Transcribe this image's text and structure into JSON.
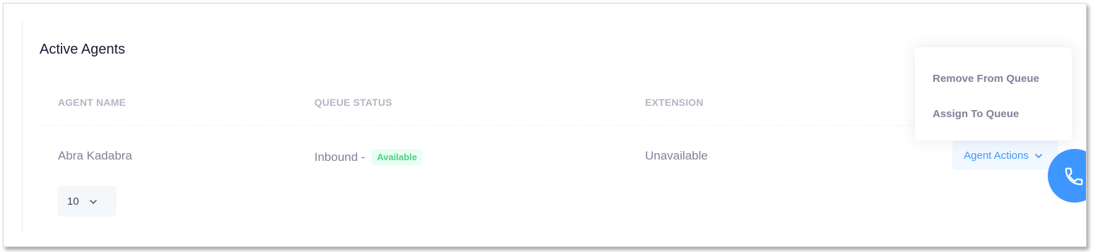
{
  "card": {
    "title": "Active Agents"
  },
  "table": {
    "columns": [
      "AGENT NAME",
      "QUEUE STATUS",
      "EXTENSION"
    ],
    "rows": [
      {
        "agent_name": "Abra Kadabra",
        "queue_status_prefix": "Inbound -",
        "queue_status_badge": "Available",
        "extension": "Unavailable",
        "actions_label": "Agent Actions"
      }
    ]
  },
  "dropdown": {
    "items": [
      "Remove From Queue",
      "Assign To Queue"
    ]
  },
  "pagination": {
    "page_size": "10"
  },
  "icons": {
    "actions_toggle": "chevron-down-icon",
    "page_size_toggle": "chevron-down-icon",
    "fab": "phone-icon"
  },
  "colors": {
    "accent": "#3e97ff",
    "badge_text": "#50cd89",
    "badge_bg": "#e8fff3"
  }
}
